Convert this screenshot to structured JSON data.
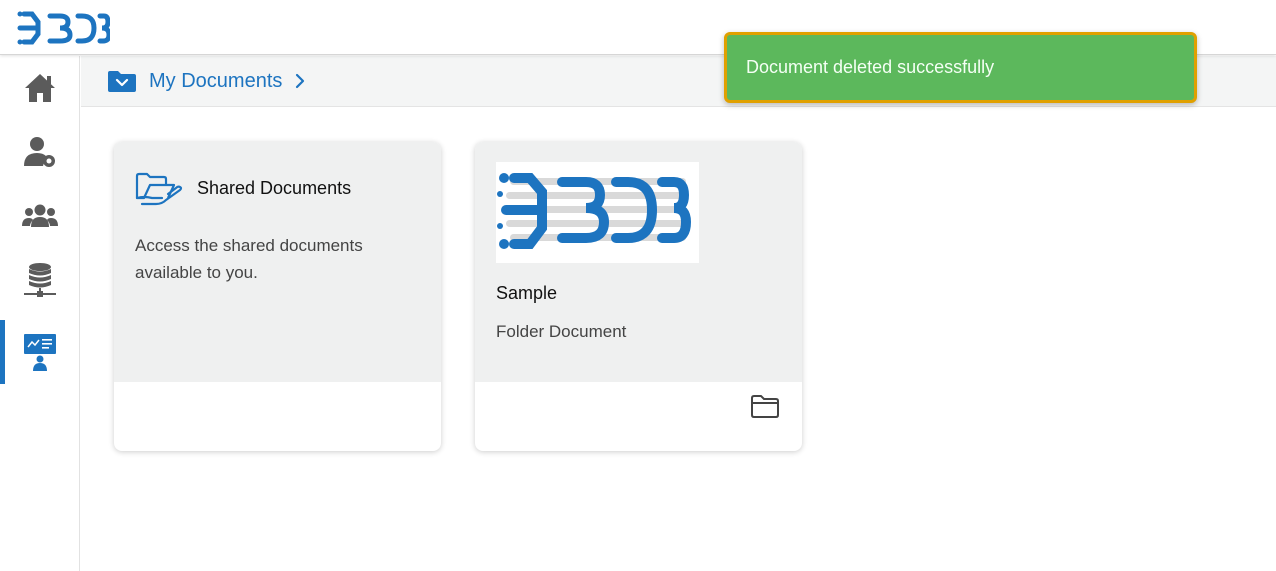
{
  "header": {
    "logo_icon": "bdb-logo-icon"
  },
  "sidebar": {
    "items": [
      {
        "name": "home",
        "icon": "home-icon"
      },
      {
        "name": "user-settings",
        "icon": "user-gear-icon"
      },
      {
        "name": "users",
        "icon": "users-group-icon"
      },
      {
        "name": "database",
        "icon": "database-network-icon"
      },
      {
        "name": "presenter",
        "icon": "presentation-user-icon",
        "active": true
      }
    ]
  },
  "breadcrumb": {
    "label": "My Documents"
  },
  "cards": [
    {
      "title": "Shared Documents",
      "description": "Access the shared documents available to you.",
      "icon": "folder-open-hand-icon"
    },
    {
      "title": "Sample",
      "subtitle": "Folder Document",
      "thumbnail_icon": "bdb-logo-icon",
      "action_icon": "folder-icon"
    }
  ],
  "toast": {
    "message": "Document deleted successfully"
  },
  "colors": {
    "brand": "#1d74c0",
    "toast_bg": "#5cb85c",
    "toast_border": "#e0a000",
    "sidebar_icon": "#5b5b5b"
  }
}
